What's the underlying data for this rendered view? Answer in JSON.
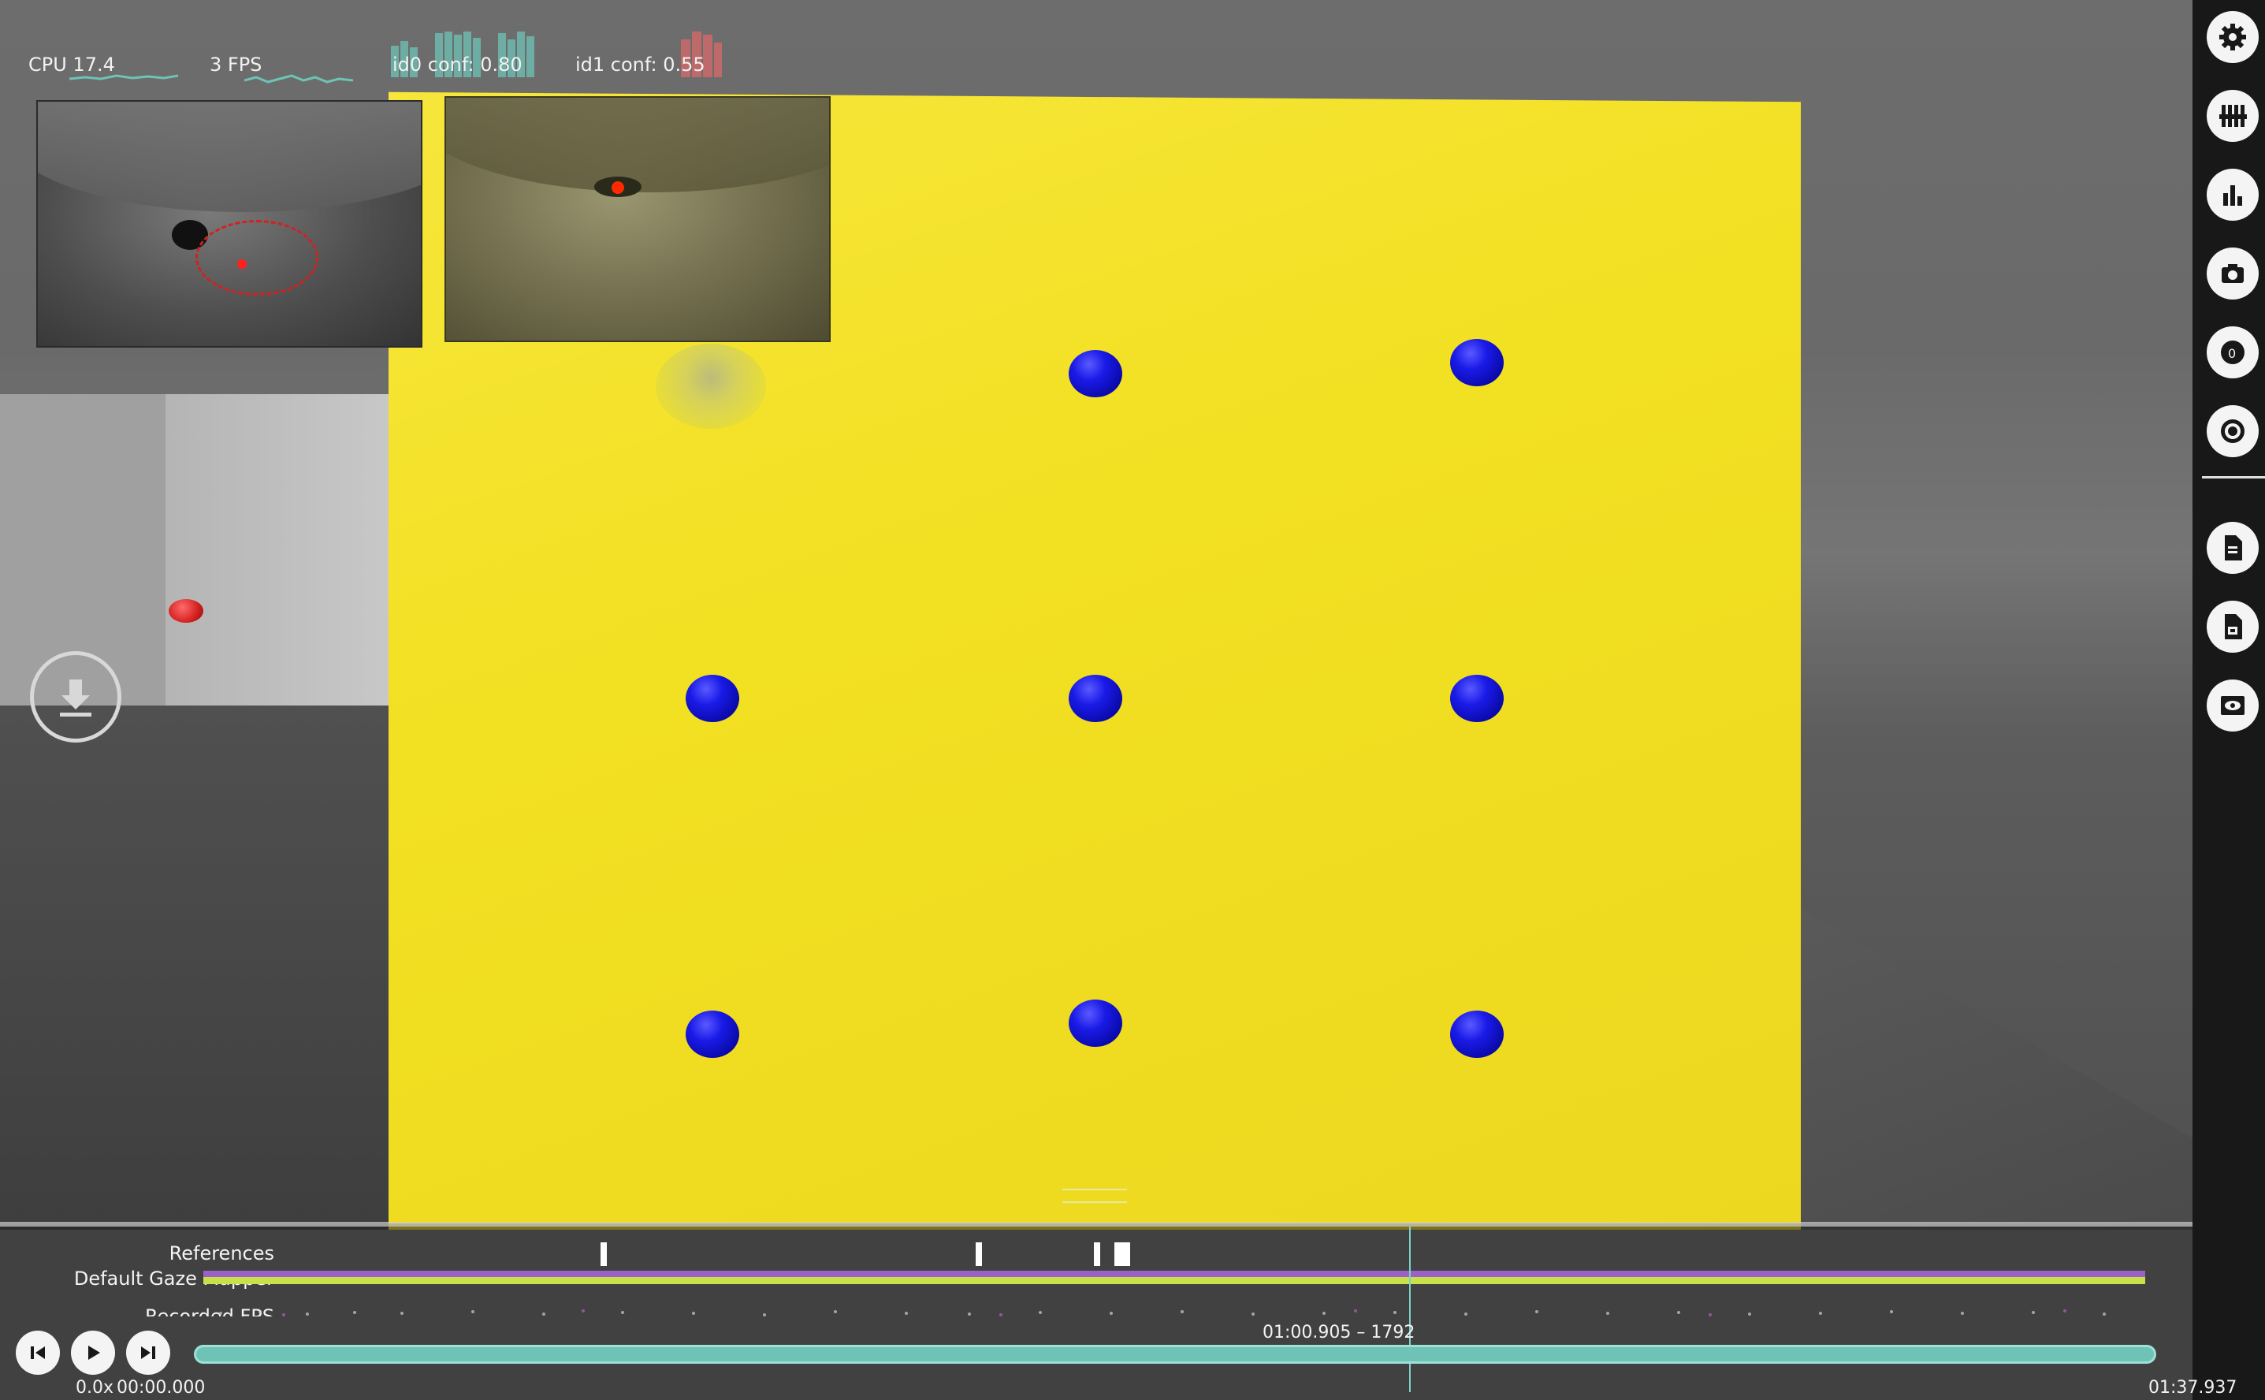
{
  "metrics": {
    "cpu": "CPU 17.4",
    "fps": "3 FPS",
    "id0": "id0 conf: 0.80",
    "id1": "id1 conf: 0.55"
  },
  "sidebar": {
    "buttons": [
      {
        "icon": "gear-icon"
      },
      {
        "icon": "plugin-sliders-icon"
      },
      {
        "icon": "bar-chart-icon"
      },
      {
        "icon": "camera-icon"
      },
      {
        "icon": "eye-0-icon"
      },
      {
        "icon": "target-icon"
      },
      {
        "icon": "document-icon"
      },
      {
        "icon": "export-document-icon"
      },
      {
        "icon": "eye-frame-icon"
      }
    ]
  },
  "timeline": {
    "rows": [
      {
        "label": "References"
      },
      {
        "label": "Default Gaze Mapper"
      },
      {
        "label": "Recorded FPS"
      }
    ],
    "current_time": "01:00.905 – 1792",
    "playback_speed": "0.0x",
    "start_time": "00:00.000",
    "end_time": "01:37.937",
    "playhead_fraction": 0.622
  },
  "colors": {
    "target_board": "#f2e022",
    "sphere": "#1a1ae8",
    "seek_bar": "#6ec3b6",
    "purple_bar": "#9a62c8",
    "green_bar": "#c8e04a"
  }
}
